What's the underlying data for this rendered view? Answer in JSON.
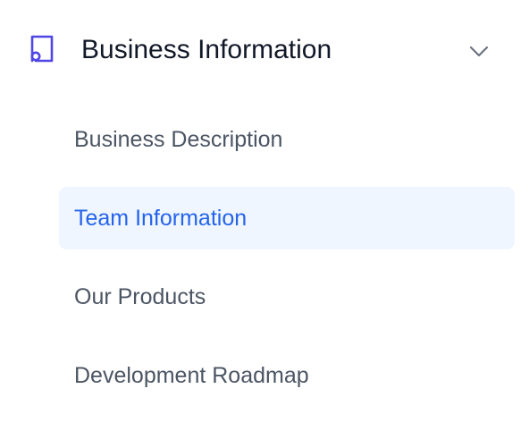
{
  "section": {
    "title": "Business Information",
    "icon": "book-icon",
    "expanded": true,
    "toggle_icon": "chevron-down-icon",
    "accent_color": "#4f46e5"
  },
  "subnav": {
    "items": [
      {
        "label": "Business Description",
        "active": false
      },
      {
        "label": "Team Information",
        "active": true
      },
      {
        "label": "Our Products",
        "active": false
      },
      {
        "label": "Development Roadmap",
        "active": false
      }
    ],
    "active_color": "#2563eb",
    "active_background": "#eff6ff",
    "text_color": "#4b5563"
  }
}
